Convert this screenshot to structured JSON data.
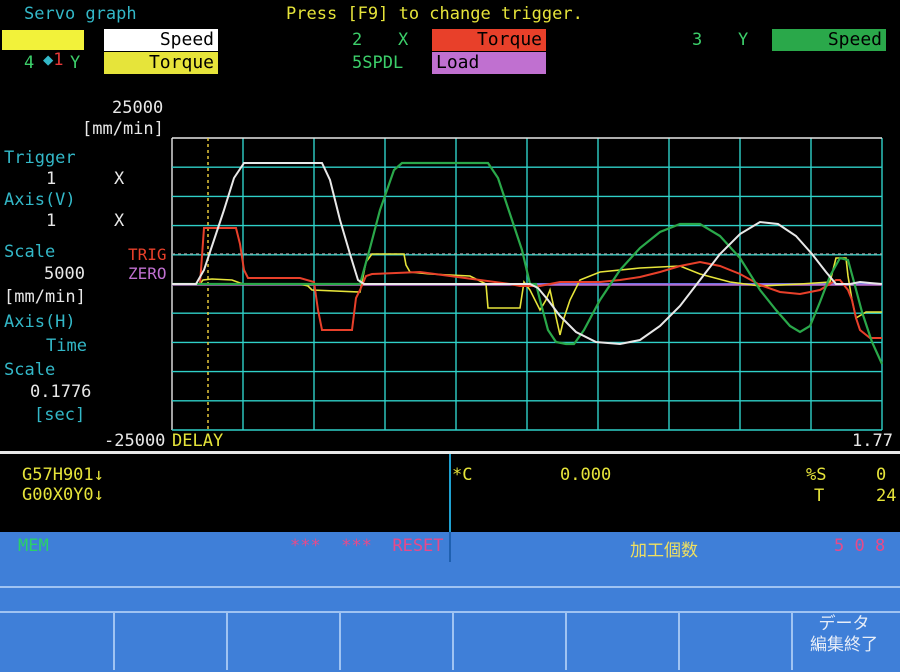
{
  "header": {
    "title": "Servo graph",
    "hint": "Press [F9] to change trigger."
  },
  "channels": [
    {
      "num": "1",
      "axis": "X",
      "signal": "Speed",
      "box_color": "#ffffff",
      "selected_marker": "◆"
    },
    {
      "num": "2",
      "axis": "X",
      "signal": "Torque",
      "box_color": "#e8402a"
    },
    {
      "num": "3",
      "axis": "Y",
      "signal": "Speed",
      "box_color": "#2aa84a"
    },
    {
      "num": "4",
      "axis": "Y",
      "signal": "Torque",
      "box_color": "#e6e43a"
    },
    {
      "num": "5SPDL",
      "axis": "",
      "signal": "Load Curr.",
      "box_color": "#c070d0"
    }
  ],
  "left_panel": {
    "y_max": "25000",
    "y_unit": "[mm/min]",
    "trigger_label": "Trigger",
    "trigger_value": "1",
    "trigger_axis": "X",
    "axis_v_label": "Axis(V)",
    "axis_v_value": "1",
    "axis_v_axis": "X",
    "scale_label": "Scale",
    "scale_v_value": "5000",
    "scale_v_unit": "[mm/min]",
    "axis_h_label": "Axis(H)",
    "axis_h_value": "Time",
    "scale_h_label": "Scale",
    "scale_h_value": "0.1776",
    "scale_h_unit": "[sec]",
    "y_min": "-25000",
    "delay_label": "DELAY",
    "x_end": "1.77"
  },
  "graph": {
    "trig_label": "TRIG",
    "zero_label": "ZERO",
    "grid_cols": 10,
    "grid_rows": 10
  },
  "program": {
    "lines": [
      "G57H901↓",
      "G00X0Y0↓"
    ],
    "coord_axis": "*C",
    "coord_value": "0.000",
    "right_labels": [
      "%S",
      "T"
    ],
    "right_values": [
      "0",
      "24"
    ]
  },
  "status": {
    "left": "MEM",
    "mode": "***  ***  RESET",
    "counter_label": "加工個数",
    "counter_value": "5 0 8"
  },
  "softkeys": [
    "",
    "",
    "",
    "",
    "",
    "",
    "",
    "データ\n編集終了"
  ],
  "colors": {
    "grid": "#2fd0c8",
    "speed_x": "#e8e8e8",
    "torque_x": "#e8402a",
    "speed_y": "#2aa84a",
    "torque_y": "#e6e43a",
    "load_curr": "#c070d0",
    "status_bar": "#3f7fd8"
  }
}
